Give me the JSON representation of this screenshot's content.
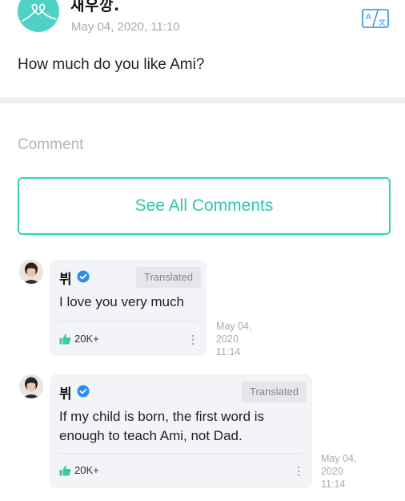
{
  "post": {
    "author_name": "새우깡.",
    "timestamp": "May 04, 2020, 11:10",
    "body": "How much do you like Ami?",
    "translate_icon": "translate-icon"
  },
  "comment_section": {
    "heading": "Comment",
    "see_all_label": "See All Comments"
  },
  "comments": [
    {
      "author": "뷔",
      "badge": "Translated",
      "text": "I love you very much",
      "likes": "20K+",
      "date_line1": "May 04,",
      "date_line2": "2020",
      "time": "11:14"
    },
    {
      "author": "뷔",
      "badge": "Translated",
      "text_line1": "If my child is born, the first word is",
      "text_line2": "enough to teach Ami, not Dad.",
      "likes": "20K+",
      "date_line1": "May 04,",
      "date_line2": "2020",
      "time": "11:14"
    }
  ],
  "colors": {
    "accent": "#2fd3b7",
    "avatar_teal": "#4fd2c5",
    "verified_blue": "#2b8cf0",
    "like_green": "#3cc9a6",
    "bubble_bg": "#f2f4f7"
  }
}
